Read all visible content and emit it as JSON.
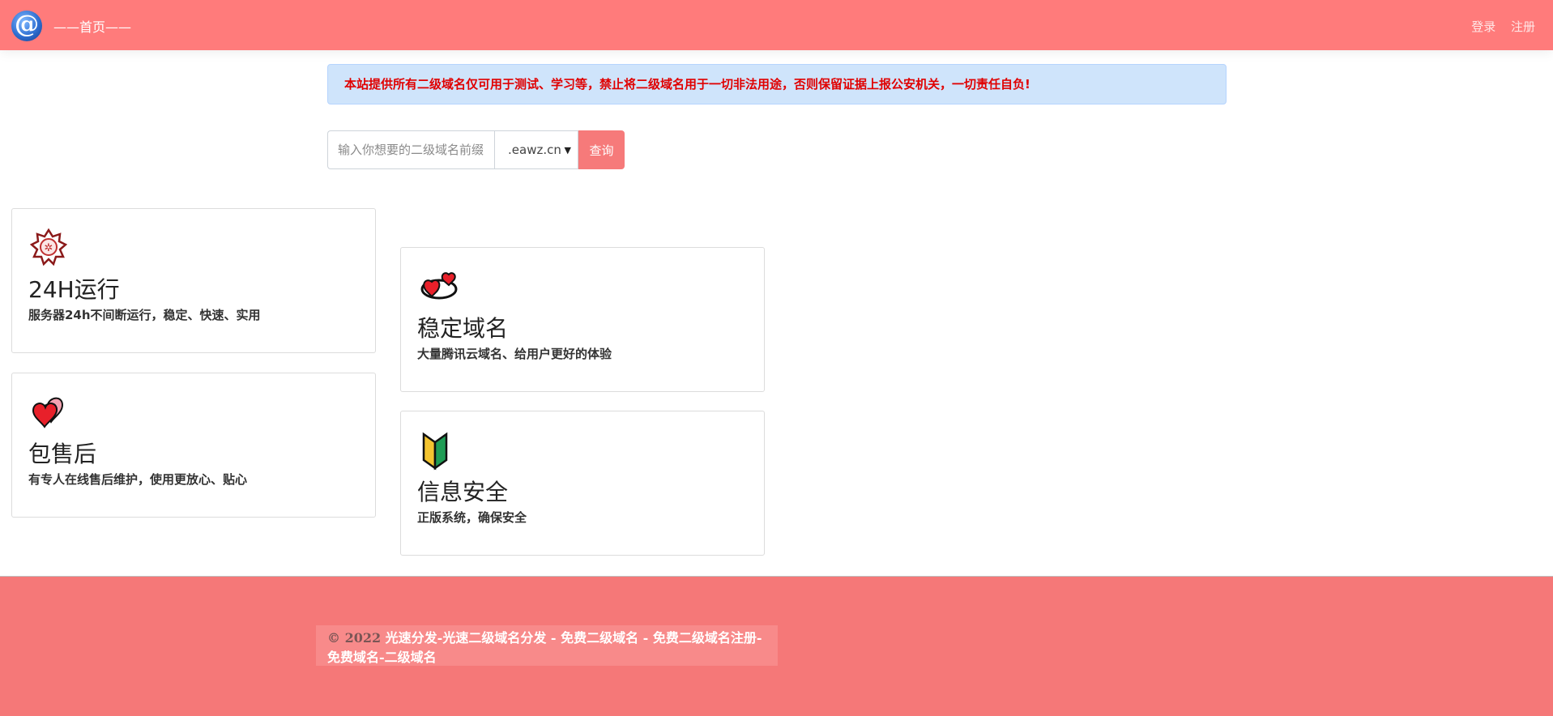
{
  "header": {
    "logo_glyph": "@",
    "brand": "——首页——",
    "login": "登录",
    "register": "注册"
  },
  "notice": "本站提供所有二级域名仅可用于测试、学习等，禁止将二级域名用于一切非法用途，否则保留证据上报公安机关，一切责任自负!",
  "search": {
    "placeholder": "输入你想要的二级域名前缀",
    "selected_domain": ".eawz.cn",
    "button": "查询"
  },
  "features": [
    {
      "icon": "flower-badge-icon",
      "title": "24H运行",
      "desc": "服务器24h不间断运行，稳定、快速、实用"
    },
    {
      "icon": "revolving-hearts-icon",
      "title": "稳定域名",
      "desc": "大量腾讯云域名、给用户更好的体验"
    },
    {
      "icon": "two-hearts-icon",
      "title": "包售后",
      "desc": "有专人在线售后维护，使用更放心、贴心"
    },
    {
      "icon": "beginner-symbol-icon",
      "title": "信息安全",
      "desc": "正版系统，确保安全"
    }
  ],
  "footer": {
    "year": "© 2022",
    "text": " 光速分发-光速二级域名分发 - 免费二级域名 - 免费二级域名注册-免费域名-二级域名"
  },
  "colors": {
    "header": "#ff7b7b",
    "footer": "#f57878",
    "notice_bg": "#cfe4fb",
    "notice_text": "#e00000"
  }
}
